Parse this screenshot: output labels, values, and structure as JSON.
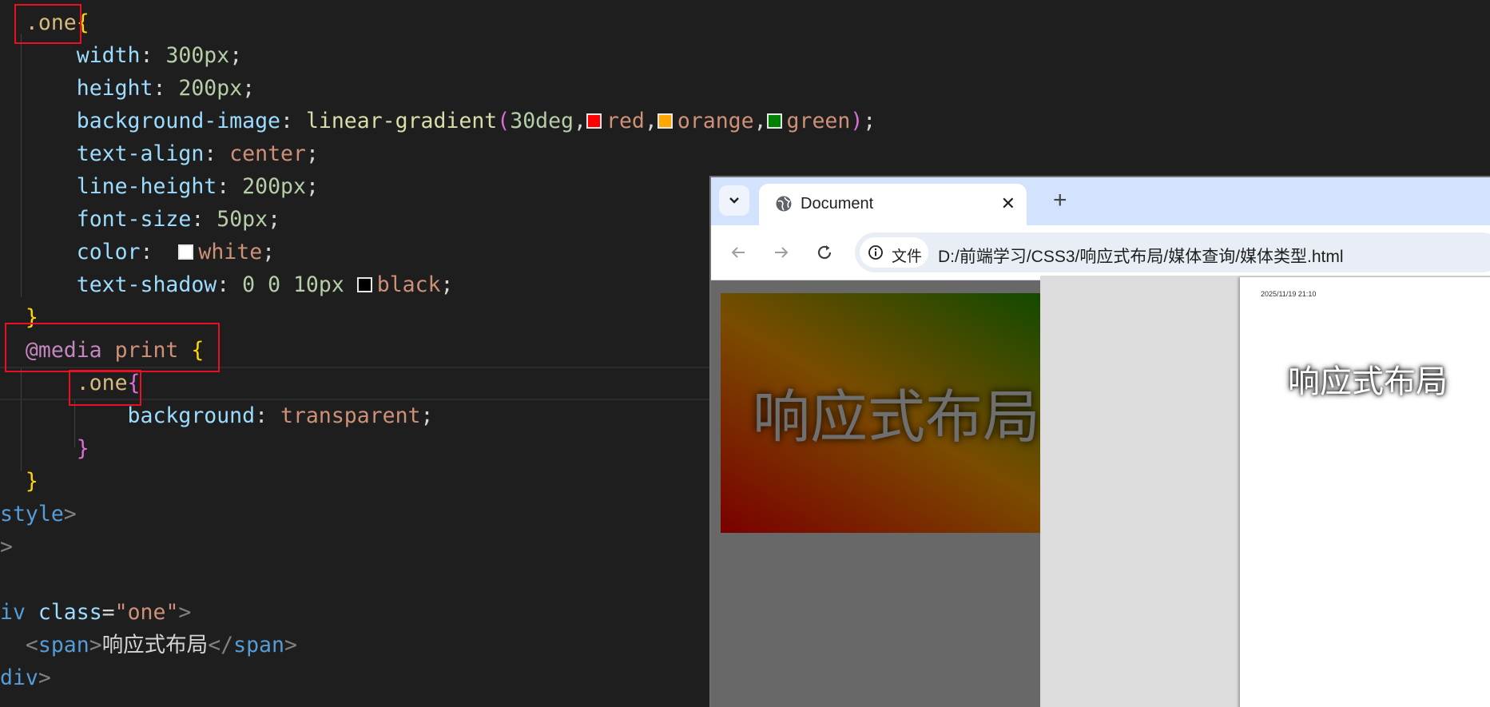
{
  "editor": {
    "lines": [
      {
        "id": "l0",
        "tokens": [
          [
            "tok-sel",
            "  .one"
          ],
          [
            "tok-brace-y",
            "{"
          ]
        ]
      },
      {
        "id": "l1",
        "tokens": [
          [
            "tok-txt",
            "      "
          ],
          [
            "tok-prop",
            "width"
          ],
          [
            "tok-txt",
            ": "
          ],
          [
            "tok-num",
            "300px"
          ],
          [
            "tok-txt",
            ";"
          ]
        ]
      },
      {
        "id": "l2",
        "tokens": [
          [
            "tok-txt",
            "      "
          ],
          [
            "tok-prop",
            "height"
          ],
          [
            "tok-txt",
            ": "
          ],
          [
            "tok-num",
            "200px"
          ],
          [
            "tok-txt",
            ";"
          ]
        ]
      },
      {
        "id": "l3",
        "tokens": [
          [
            "tok-txt",
            "      "
          ],
          [
            "tok-prop",
            "background-image"
          ],
          [
            "tok-txt",
            ": "
          ],
          [
            "tok-fn",
            "linear-gradient"
          ],
          [
            "tok-brace-p",
            "("
          ],
          [
            "tok-num",
            "30deg"
          ],
          [
            "tok-txt",
            ","
          ],
          [
            "swatch",
            "#ff0000"
          ],
          [
            "tok-val",
            "red"
          ],
          [
            "tok-txt",
            ","
          ],
          [
            "swatch",
            "#ffa500"
          ],
          [
            "tok-val",
            "orange"
          ],
          [
            "tok-txt",
            ","
          ],
          [
            "swatch",
            "#008000"
          ],
          [
            "tok-val",
            "green"
          ],
          [
            "tok-brace-p",
            ")"
          ],
          [
            "tok-txt",
            ";"
          ]
        ]
      },
      {
        "id": "l4",
        "tokens": [
          [
            "tok-txt",
            "      "
          ],
          [
            "tok-prop",
            "text-align"
          ],
          [
            "tok-txt",
            ": "
          ],
          [
            "tok-val",
            "center"
          ],
          [
            "tok-txt",
            ";"
          ]
        ]
      },
      {
        "id": "l5",
        "tokens": [
          [
            "tok-txt",
            "      "
          ],
          [
            "tok-prop",
            "line-height"
          ],
          [
            "tok-txt",
            ": "
          ],
          [
            "tok-num",
            "200px"
          ],
          [
            "tok-txt",
            ";"
          ]
        ]
      },
      {
        "id": "l6",
        "tokens": [
          [
            "tok-txt",
            "      "
          ],
          [
            "tok-prop",
            "font-size"
          ],
          [
            "tok-txt",
            ": "
          ],
          [
            "tok-num",
            "50px"
          ],
          [
            "tok-txt",
            ";"
          ]
        ]
      },
      {
        "id": "l7",
        "tokens": [
          [
            "tok-txt",
            "      "
          ],
          [
            "tok-prop",
            "color"
          ],
          [
            "tok-txt",
            ":  "
          ],
          [
            "swatch",
            "#ffffff"
          ],
          [
            "tok-val",
            "white"
          ],
          [
            "tok-txt",
            ";"
          ]
        ]
      },
      {
        "id": "l8",
        "tokens": [
          [
            "tok-txt",
            "      "
          ],
          [
            "tok-prop",
            "text-shadow"
          ],
          [
            "tok-txt",
            ": "
          ],
          [
            "tok-num",
            "0 0 10px "
          ],
          [
            "swatch",
            "#000000"
          ],
          [
            "tok-val",
            "black"
          ],
          [
            "tok-txt",
            ";"
          ]
        ]
      },
      {
        "id": "l9",
        "tokens": [
          [
            "tok-brace-y",
            "  }"
          ]
        ]
      },
      {
        "id": "l10",
        "tokens": [
          [
            "tok-at",
            "  @media "
          ],
          [
            "tok-val",
            "print"
          ],
          [
            "tok-txt",
            " "
          ],
          [
            "tok-brace-y",
            "{"
          ]
        ]
      },
      {
        "id": "l11",
        "tokens": [
          [
            "tok-sel",
            "      .one"
          ],
          [
            "tok-brace-p",
            "{"
          ]
        ]
      },
      {
        "id": "l12",
        "tokens": [
          [
            "tok-txt",
            "          "
          ],
          [
            "tok-prop",
            "background"
          ],
          [
            "tok-txt",
            ": "
          ],
          [
            "tok-val",
            "transparent"
          ],
          [
            "tok-txt",
            ";"
          ]
        ]
      },
      {
        "id": "l13",
        "tokens": [
          [
            "tok-brace-p",
            "      }"
          ]
        ]
      },
      {
        "id": "l14",
        "tokens": [
          [
            "tok-brace-y",
            "  }"
          ]
        ]
      },
      {
        "id": "l15",
        "tokens": [
          [
            "tok-tag",
            "style"
          ],
          [
            "tok-punct",
            ">"
          ]
        ]
      },
      {
        "id": "l16",
        "tokens": [
          [
            "tok-punct",
            ">"
          ]
        ]
      },
      {
        "id": "l17",
        "tokens": [
          [
            "tok-txt",
            ""
          ]
        ]
      },
      {
        "id": "l18",
        "tokens": [
          [
            "tok-tag",
            "iv "
          ],
          [
            "tok-prop",
            "class"
          ],
          [
            "tok-txt",
            "="
          ],
          [
            "tok-val",
            "\"one\""
          ],
          [
            "tok-punct",
            ">"
          ]
        ]
      },
      {
        "id": "l19",
        "tokens": [
          [
            "tok-txt",
            "  "
          ],
          [
            "tok-punct",
            "<"
          ],
          [
            "tok-tag",
            "span"
          ],
          [
            "tok-punct",
            ">"
          ],
          [
            "tok-txt",
            "响应式布局"
          ],
          [
            "tok-punct",
            "</"
          ],
          [
            "tok-tag",
            "span"
          ],
          [
            "tok-punct",
            ">"
          ]
        ]
      },
      {
        "id": "l20",
        "tokens": [
          [
            "tok-tag",
            "div"
          ],
          [
            "tok-punct",
            ">"
          ]
        ]
      }
    ]
  },
  "browser": {
    "tab_title": "Document",
    "new_tab_label": "+",
    "site_chip_label": "文件",
    "url": "D:/前端学习/CSS3/响应式布局/媒体查询/媒体类型.html",
    "page_text": "响应式布局",
    "print_preview": {
      "header_timestamp": "2025/11/19 21:10",
      "title": "响应式布局"
    }
  }
}
